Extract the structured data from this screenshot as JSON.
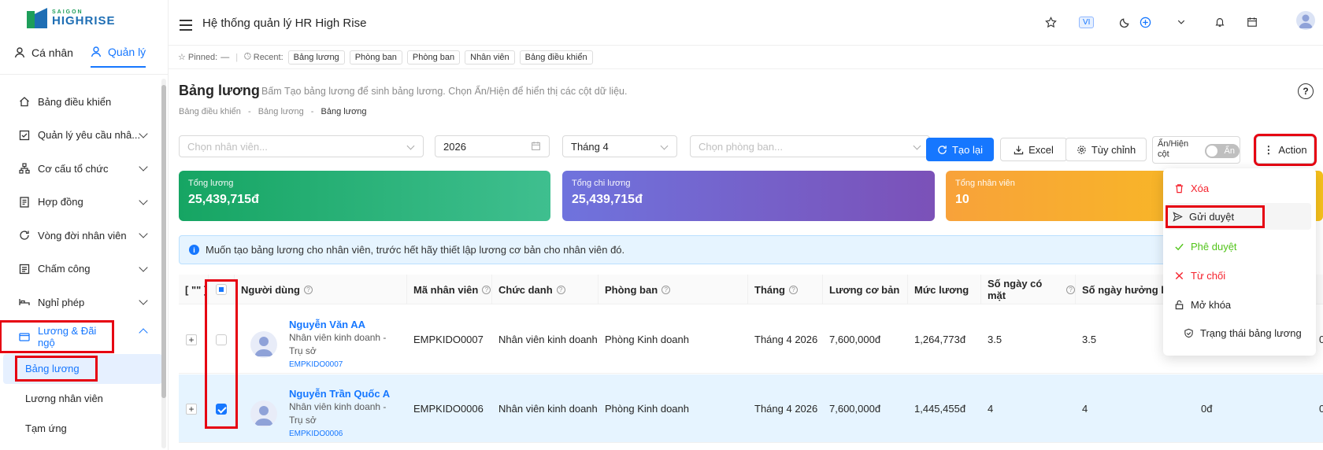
{
  "brand": {
    "line1": "SAIGON",
    "line2": "HIGHRISE"
  },
  "roles": [
    {
      "label": "Cá nhân"
    },
    {
      "label": "Quản lý"
    }
  ],
  "menu": [
    {
      "label": "Bảng điều khiển"
    },
    {
      "label": "Quản lý yêu cầu nhâ..."
    },
    {
      "label": "Cơ cấu tổ chức"
    },
    {
      "label": "Hợp đồng"
    },
    {
      "label": "Vòng đời nhân viên"
    },
    {
      "label": "Chấm công"
    },
    {
      "label": "Nghỉ phép"
    },
    {
      "label": "Lương & Đãi ngộ"
    }
  ],
  "submenu": [
    {
      "label": "Bảng lương"
    },
    {
      "label": "Lương nhân viên"
    },
    {
      "label": "Tạm ứng"
    }
  ],
  "header": {
    "title": "Hệ thống quản lý HR High Rise",
    "lang": "VI"
  },
  "pinbar": {
    "pinned_label": "Pinned:",
    "pinned_value": "—",
    "recent_label": "Recent:",
    "recent": [
      "Bảng lương",
      "Phòng ban",
      "Phòng ban",
      "Nhân viên",
      "Bảng điều khiển"
    ]
  },
  "page": {
    "title": "Bảng lương",
    "hint": "Bấm Tạo bảng lương để sinh bảng lương. Chọn Ẩn/Hiện để hiển thị các cột dữ liệu.",
    "crumbs": [
      "Bảng điều khiển",
      "Bảng lương",
      "Bảng lương"
    ],
    "help": "?"
  },
  "filters": {
    "employee_placeholder": "Chọn nhân viên...",
    "year": "2026",
    "month": "Tháng 4",
    "dept_placeholder": "Chọn phòng ban..."
  },
  "buttons": {
    "regen": "Tạo lại",
    "excel": "Excel",
    "custom": "Tùy chỉnh",
    "toggle_label_1": "Ẩn/Hiện",
    "toggle_label_2": "cột",
    "toggle_state": "Ẩn",
    "action": "Action"
  },
  "cards": [
    {
      "label": "Tổng lương",
      "value": "25,439,715đ",
      "color": "#1aa86b"
    },
    {
      "label": "Tổng chi lương",
      "value": "25,439,715đ",
      "color": "#6b5fd3"
    },
    {
      "label": "Tổng nhân viên",
      "value": "10",
      "color": "#f7a600"
    }
  ],
  "info": "Muốn tạo bảng lương cho nhân viên, trước hết hãy thiết lập lương cơ bản cho nhân viên đó.",
  "table": {
    "headers": [
      "[ \"\" ]",
      "Người dùng",
      "Mã nhân viên",
      "Chức danh",
      "Phòng ban",
      "Tháng",
      "Lương cơ bản",
      "Mức lương",
      "Số ngày có mặt",
      "Số ngày hưởng lươ"
    ],
    "rows": [
      {
        "name": "Nguyễn Văn AA",
        "role1": "Nhân viên kinh doanh -",
        "role2": "Trụ sở",
        "code_small": "EMPKIDO0007",
        "code": "EMPKIDO0007",
        "title": "Nhân viên kinh doanh",
        "dept": "Phòng Kinh doanh",
        "month": "Tháng 4 2026",
        "base": "7,600,000đ",
        "salary": "1,264,773đ",
        "present": "3.5",
        "paid": "3.5",
        "extra": "",
        "edge": "0"
      },
      {
        "name": "Nguyễn Trần Quốc A",
        "role1": "Nhân viên kinh doanh -",
        "role2": "Trụ sở",
        "code_small": "EMPKIDO0006",
        "code": "EMPKIDO0006",
        "title": "Nhân viên kinh doanh",
        "dept": "Phòng Kinh doanh",
        "month": "Tháng 4 2026",
        "base": "7,600,000đ",
        "salary": "1,445,455đ",
        "present": "4",
        "paid": "4",
        "extra": "0đ",
        "edge": "0"
      }
    ]
  },
  "actions": [
    {
      "label": "Xóa",
      "color": "#f5222d"
    },
    {
      "label": "Gửi duyệt",
      "color": "#262626"
    },
    {
      "label": "Phê duyệt",
      "color": "#52c41a"
    },
    {
      "label": "Từ chối",
      "color": "#f5222d"
    },
    {
      "label": "Mở khóa",
      "color": "#262626"
    },
    {
      "label": "Trạng thái bảng lương",
      "color": "#262626"
    }
  ]
}
